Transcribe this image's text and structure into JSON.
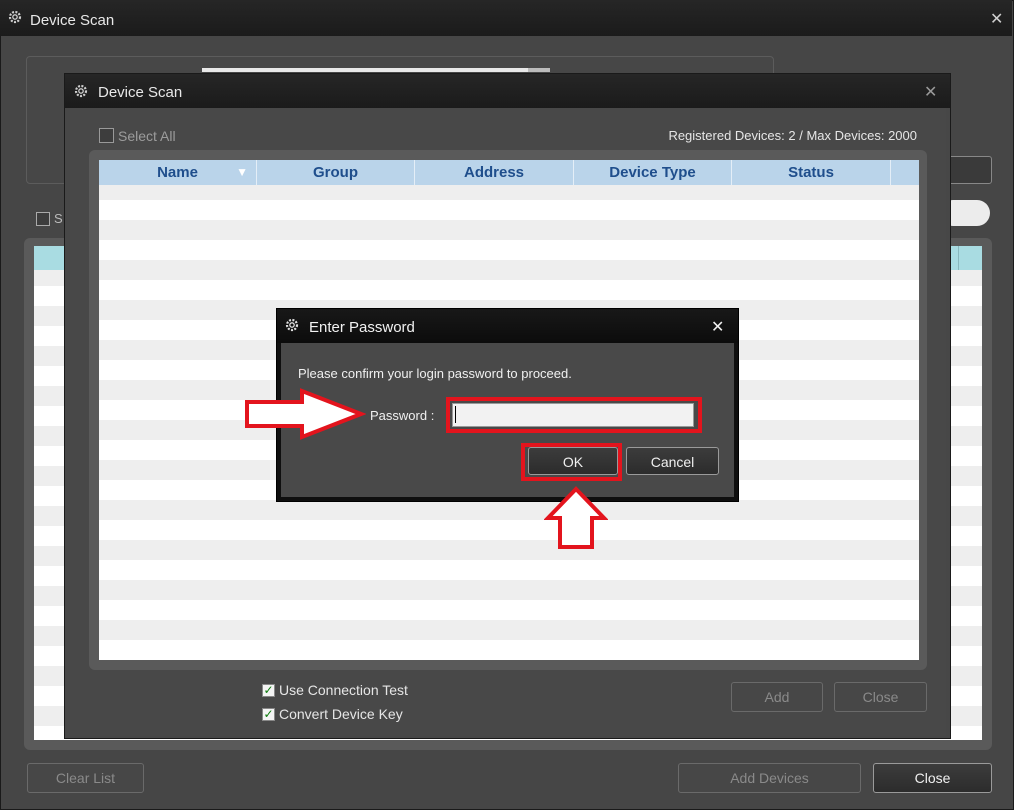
{
  "outer_window": {
    "title": "Device Scan",
    "partial_checkbox_text": "S",
    "clear_list_label": "Clear List",
    "add_devices_label": "Add Devices",
    "close_label": "Close"
  },
  "inner_window": {
    "title": "Device Scan",
    "select_all_label": "Select All",
    "registered_devices": "Registered Devices: 2 / Max Devices: 2000",
    "columns": [
      "Name",
      "Group",
      "Address",
      "Device Type",
      "Status"
    ],
    "use_connection_test": {
      "label": "Use Connection Test",
      "checked": true
    },
    "convert_device_key": {
      "label": "Convert Device Key",
      "checked": true
    },
    "add_label": "Add",
    "close_label": "Close"
  },
  "password_dialog": {
    "title": "Enter Password",
    "message": "Please confirm your login password to proceed.",
    "password_label": "Password :",
    "password_value": "",
    "ok_label": "OK",
    "cancel_label": "Cancel"
  },
  "icons": {
    "title_icon": "gear-icon",
    "close_icon": "close-icon",
    "sort_icon": "sort-down-icon",
    "check_icon": "checkmark-icon",
    "annotation_arrows": [
      "right-arrow-annotation",
      "up-arrow-annotation"
    ]
  },
  "colors": {
    "highlight": "#e3141d",
    "header_text": "#1f4e8c",
    "header_bg": "#bad4ea",
    "checkmark": "#0c7a0c"
  }
}
